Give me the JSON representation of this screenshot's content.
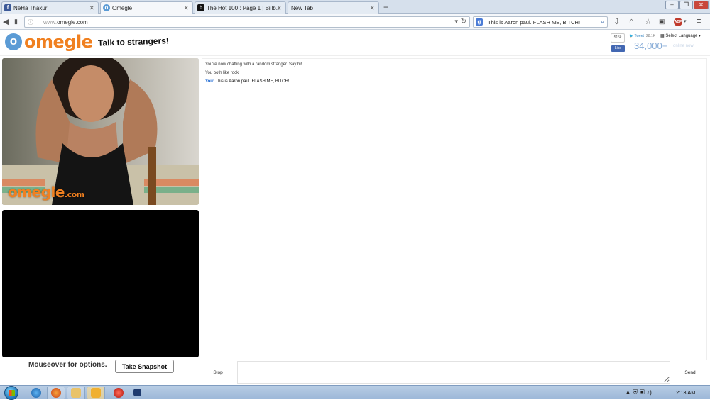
{
  "browser": {
    "tabs": [
      {
        "title": "NeHa Thakur",
        "favicon": "facebook-icon",
        "color": "#3b5998",
        "glyph": "f"
      },
      {
        "title": "Omegle",
        "favicon": "omegle-icon",
        "color": "#5b9bd5",
        "glyph": "o"
      },
      {
        "title": "The Hot 100 : Page 1 | Billb...",
        "favicon": "billboard-icon",
        "color": "#111111",
        "glyph": "b"
      },
      {
        "title": "New Tab",
        "favicon": "",
        "color": "",
        "glyph": ""
      }
    ],
    "url": {
      "prefix": "www.",
      "domain": "omegle.com"
    },
    "search_text": "This is Aaron paul. FLASH ME, BITCH!"
  },
  "omegle": {
    "logo_glyph": "o",
    "logo_word": "omegle",
    "tagline": "Talk to strangers!",
    "fb_count": "515k",
    "fb_like": "Like",
    "tweet": "Tweet",
    "tweet_count": "28.1K",
    "language": "Select Language",
    "online_count": "34,000+",
    "online_label": "online now"
  },
  "video": {
    "watermark": "omegle",
    "watermark_tld": ".com"
  },
  "controls": {
    "mouseover": "Mouseover for options.",
    "snapshot": "Take Snapshot"
  },
  "chat": {
    "log": [
      {
        "text": "You're now chatting with a random stranger. Say hi!"
      },
      {
        "text": "You both like rock"
      }
    ],
    "you_label": "You:",
    "you_message": "This is Aaron paul. FLASH ME, BITCH!",
    "stop": "Stop",
    "send": "Send"
  },
  "taskbar": {
    "clock": "2:13 AM"
  },
  "colors": {
    "omegle_orange": "#f08020",
    "omegle_blue": "#5b9bd5",
    "you_blue": "#1060d0"
  }
}
